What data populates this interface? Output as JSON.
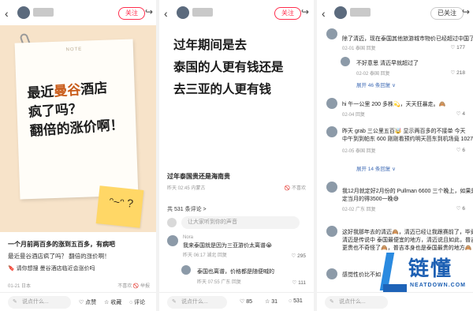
{
  "panel1": {
    "follow_label": "关注",
    "note_label": "NOTE",
    "note_lines": [
      "最近",
      "曼谷",
      "酒店",
      "疯了吗？",
      "翻倍的涨价啊！"
    ],
    "sticky_face": "ᵔ~ᵔ ?",
    "title": "一个月前两百多的涨到五百多，有病吧",
    "subtitle": "最近曼谷酒店疯了吗？ 翻倍的涨价啊！",
    "tags": "🔖 请你想搜   曼谷酒店临近会涨价吗",
    "date": "01-21 日本",
    "report": "不喜欢  🚫 举报",
    "bottom": {
      "input": "说点什么...",
      "like": "点赞",
      "collect": "收藏",
      "comment": "评论"
    }
  },
  "panel2": {
    "follow_label": "关注",
    "big_text": [
      "过年期间是去",
      "泰国的人更有钱还是",
      "去三亚的人更有钱"
    ],
    "title": "过年泰国贵还是海南贵",
    "date": "昨天 02:45 内蒙古",
    "report": "🚫 不喜欢",
    "comment_count": "共 531 条评论 >",
    "input_placeholder": "让大家听到你的声音",
    "comments": [
      {
        "name": "Nora",
        "text": "我来泰国就是因为三亚游价太离谱😭",
        "meta": "昨天 06:17 湖北  回复",
        "likes": "♡ 295"
      },
      {
        "name": "",
        "text": "泰国也离谱，价格都是随便喊的",
        "meta": "昨天 07:55 广东  回复",
        "likes": "♡ 111"
      }
    ],
    "bottom": {
      "input": "说点什么...",
      "like": "85",
      "collect": "31",
      "comment": "531"
    }
  },
  "panel3": {
    "follow_label": "已关注",
    "comments": [
      {
        "text": "除了清迈，现在泰国其他旅游城市物价已经超过中国了",
        "meta": "02-01 泰国  回复",
        "likes": "♡ 177"
      },
      {
        "text": "不好意思 清迈早就超过了",
        "meta": "02-02 泰国  回复",
        "likes": "♡ 218"
      },
      {
        "text": "hi 午一公里 200 多株💫，天天狂暴走。🙈",
        "meta": "02-04 回复",
        "likes": "♡ 4"
      },
      {
        "text": "昨天 grab 三公里五百🤯  显示两百多的不接单 今天",
        "text2": "中午到到帕东 600 刚刚看预约明天芭东到机场竟 1027",
        "meta": "02-05 泰国  回复",
        "likes": "♡ 6"
      },
      {
        "text": "我12月就定好2月份的 Pullman 6600 三个晚上，如果是",
        "text2": "定当月的得3500一晚😅",
        "meta": "02-02 广东  回复",
        "likes": "♡ 6"
      },
      {
        "text": "这好我那年去的清迈🙈，清迈已经让我跟赛前了，毕竟",
        "text2": "清迈是传说中 泰国最便宜的地方，清迈说且如此，普吉",
        "text3": "更贵也不奇怪了🙈，普吉本身也是泰国最贵的地方🙈",
        "meta": "",
        "likes": ""
      },
      {
        "text": "感觉性价比不如",
        "meta": "",
        "likes": ""
      }
    ],
    "expands": [
      "展开 46 条回复 ∨",
      "展开 14 条回复 ∨"
    ],
    "bottom": {
      "input": "说点什么..."
    }
  },
  "watermark": {
    "cn": "链懂",
    "en": "NEATDOWN.COM"
  },
  "colors": {
    "accent": "#ff2e4d",
    "link": "#3f6bb5",
    "note_bg": "#f7e3c9",
    "sticky": "#ffd766",
    "brand_blue": "#1c5fb3"
  }
}
